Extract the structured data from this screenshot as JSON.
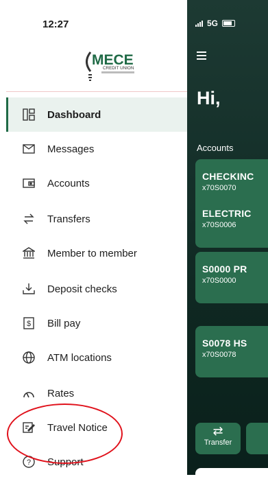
{
  "status": {
    "time": "12:27",
    "network": "5G"
  },
  "brand": {
    "name": "MECE",
    "subtitle": "CREDIT UNION"
  },
  "nav": {
    "items": [
      {
        "label": "Dashboard",
        "icon": "dashboard-icon"
      },
      {
        "label": "Messages",
        "icon": "envelope-icon"
      },
      {
        "label": "Accounts",
        "icon": "wallet-icon"
      },
      {
        "label": "Transfers",
        "icon": "transfer-arrows-icon"
      },
      {
        "label": "Member to member",
        "icon": "bank-icon"
      },
      {
        "label": "Deposit checks",
        "icon": "download-tray-icon"
      },
      {
        "label": "Bill pay",
        "icon": "dollar-doc-icon"
      },
      {
        "label": "ATM locations",
        "icon": "globe-icon"
      },
      {
        "label": "Rates",
        "icon": "gauge-icon"
      },
      {
        "label": "Travel Notice",
        "icon": "edit-note-icon"
      },
      {
        "label": "Support",
        "icon": "help-circle-icon"
      }
    ],
    "active_index": 0
  },
  "background_app": {
    "greeting": "Hi,",
    "accounts_title": "Accounts",
    "accounts": [
      {
        "name": "CHECKINC",
        "number": "x70S0070"
      },
      {
        "name": "ELECTRIC",
        "number": "x70S0006"
      },
      {
        "name": "S0000 PR",
        "number": "x70S0000"
      },
      {
        "name": "S0078 HS",
        "number": "x70S0078"
      }
    ],
    "transfer_label": "Transfer"
  },
  "colors": {
    "primary": "#2b6e4f",
    "active_bg": "#eaf2ee",
    "annotation": "#e0111b"
  }
}
